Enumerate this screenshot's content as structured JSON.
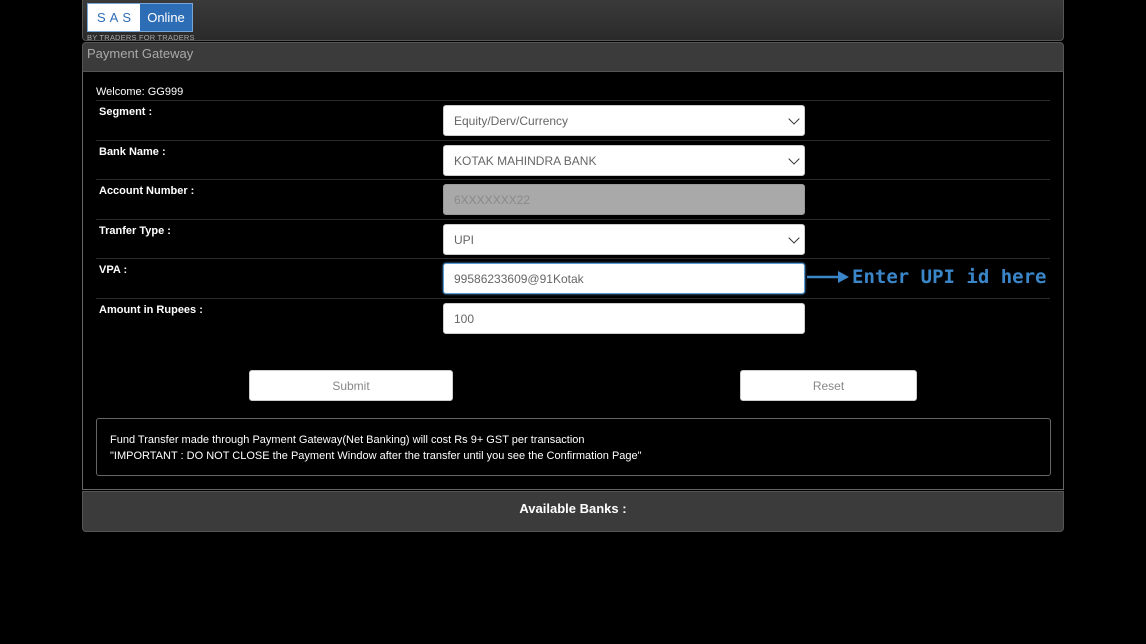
{
  "brand": {
    "logo_left": "SAS",
    "logo_right": "Online",
    "tagline": "BY TRADERS FOR TRADERS"
  },
  "header": {
    "title": "Payment Gateway"
  },
  "form": {
    "welcome": "Welcome: GG999",
    "segment": {
      "label": "Segment :",
      "value": "Equity/Derv/Currency"
    },
    "bank_name": {
      "label": "Bank Name :",
      "value": "KOTAK MAHINDRA BANK"
    },
    "account_number": {
      "label": "Account Number :",
      "value": "6XXXXXXX22"
    },
    "transfer_type": {
      "label": "Tranfer Type :",
      "value": "UPI"
    },
    "vpa": {
      "label": "VPA :",
      "value": "99586233609@91Kotak"
    },
    "amount": {
      "label": "Amount in Rupees :",
      "value": "100"
    },
    "submit_label": "Submit",
    "reset_label": "Reset"
  },
  "notice": {
    "line1": "Fund Transfer made through Payment Gateway(Net Banking) will cost Rs 9+ GST per transaction",
    "line2": "\"IMPORTANT : DO NOT CLOSE the Payment Window after the transfer until you see the Confirmation Page\""
  },
  "footer": {
    "available_banks": "Available Banks :"
  },
  "annotation": {
    "text": "Enter UPI id here",
    "color": "#3a86c8"
  },
  "colors": {
    "brand_blue": "#2d6db5",
    "background": "#000000",
    "panel_header": "#3b3b3b"
  }
}
